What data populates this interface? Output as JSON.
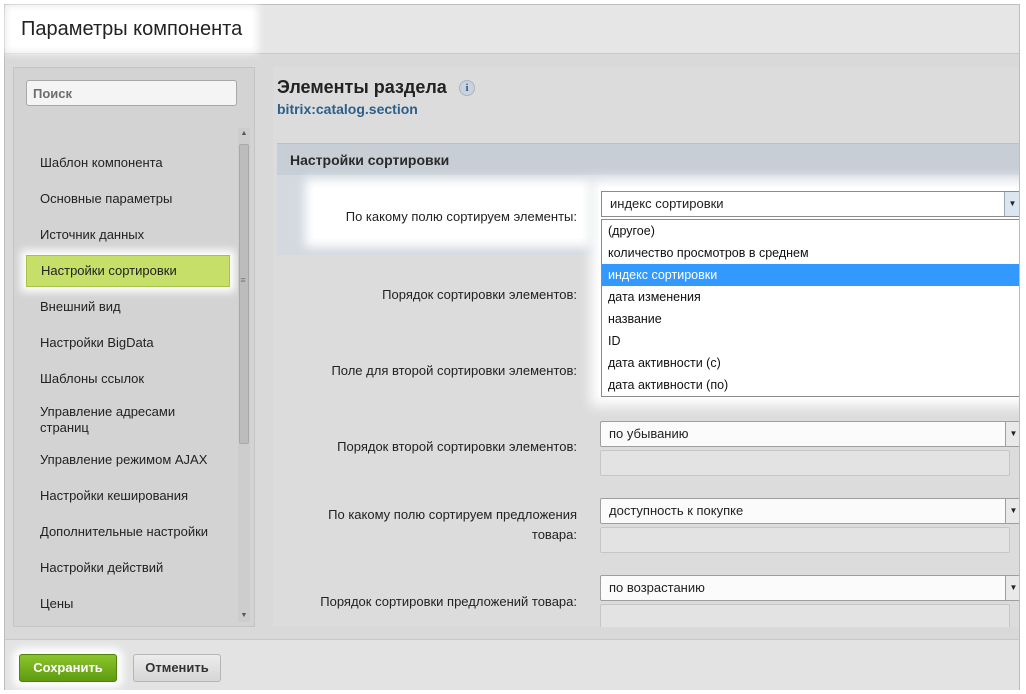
{
  "window": {
    "title": "Параметры компонента"
  },
  "sidebar": {
    "search_placeholder": "Поиск",
    "items": [
      {
        "label": "Шаблон компонента"
      },
      {
        "label": "Основные параметры"
      },
      {
        "label": "Источник данных"
      },
      {
        "label": "Настройки сортировки"
      },
      {
        "label": "Внешний вид"
      },
      {
        "label": "Настройки BigData"
      },
      {
        "label": "Шаблоны ссылок"
      },
      {
        "label": "Управление адресами страниц"
      },
      {
        "label": "Управление режимом AJAX"
      },
      {
        "label": "Настройки кеширования"
      },
      {
        "label": "Дополнительные настройки"
      },
      {
        "label": "Настройки действий"
      },
      {
        "label": "Цены"
      }
    ],
    "active_item": "Настройки сортировки"
  },
  "component": {
    "title": "Элементы раздела",
    "info_icon": "i",
    "code": "bitrix:catalog.section"
  },
  "section": {
    "title": "Настройки сортировки",
    "fields": [
      {
        "label": "По какому полю сортируем элементы:",
        "value": "индекс сортировки"
      },
      {
        "label": "Порядок сортировки элементов:",
        "value": ""
      },
      {
        "label": "Поле для второй сортировки элементов:",
        "value": ""
      },
      {
        "label": "Порядок второй сортировки элементов:",
        "value": "по убыванию"
      },
      {
        "label": "По какому полю сортируем предложения товара:",
        "value": "доступность к покупке"
      },
      {
        "label": "Порядок сортировки предложений товара:",
        "value": "по возрастанию"
      }
    ]
  },
  "dropdown": {
    "selected": "индекс сортировки",
    "options": [
      "(другое)",
      "количество просмотров в среднем",
      "индекс сортировки",
      "дата изменения",
      "название",
      "ID",
      "дата активности (с)",
      "дата активности (по)"
    ],
    "highlighted_index": 2
  },
  "footer": {
    "save_label": "Сохранить",
    "cancel_label": "Отменить"
  },
  "colors": {
    "save_button": "#6aaa16",
    "active_item": "#c6df68",
    "dropdown_highlight": "#3399ff",
    "link_code": "#2c5f8a"
  }
}
